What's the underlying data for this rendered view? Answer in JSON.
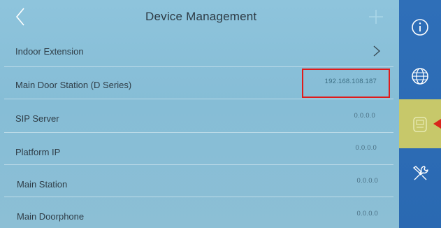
{
  "header": {
    "title": "Device Management"
  },
  "rows": [
    {
      "label": "Indoor Extension",
      "value": ""
    },
    {
      "label": "Main Door Station (D Series)",
      "value": "192.168.108.187"
    },
    {
      "label": "SIP Server",
      "value": "0.0.0.0"
    },
    {
      "label": "Platform IP",
      "value": "0.0.0.0"
    },
    {
      "label": "Main Station",
      "value": "0.0.0.0"
    },
    {
      "label": "Main Doorphone",
      "value": "0.0.0.0"
    }
  ],
  "sidebar": {
    "items": [
      {
        "icon": "info-icon",
        "active": false
      },
      {
        "icon": "globe-icon",
        "active": false
      },
      {
        "icon": "device-icon",
        "active": true
      },
      {
        "icon": "tools-icon",
        "active": false
      }
    ]
  },
  "colors": {
    "background": "#8ec4dc",
    "sidebar": "#2f6fb8",
    "active": "#c7c86a",
    "highlight": "#e01b1b"
  }
}
